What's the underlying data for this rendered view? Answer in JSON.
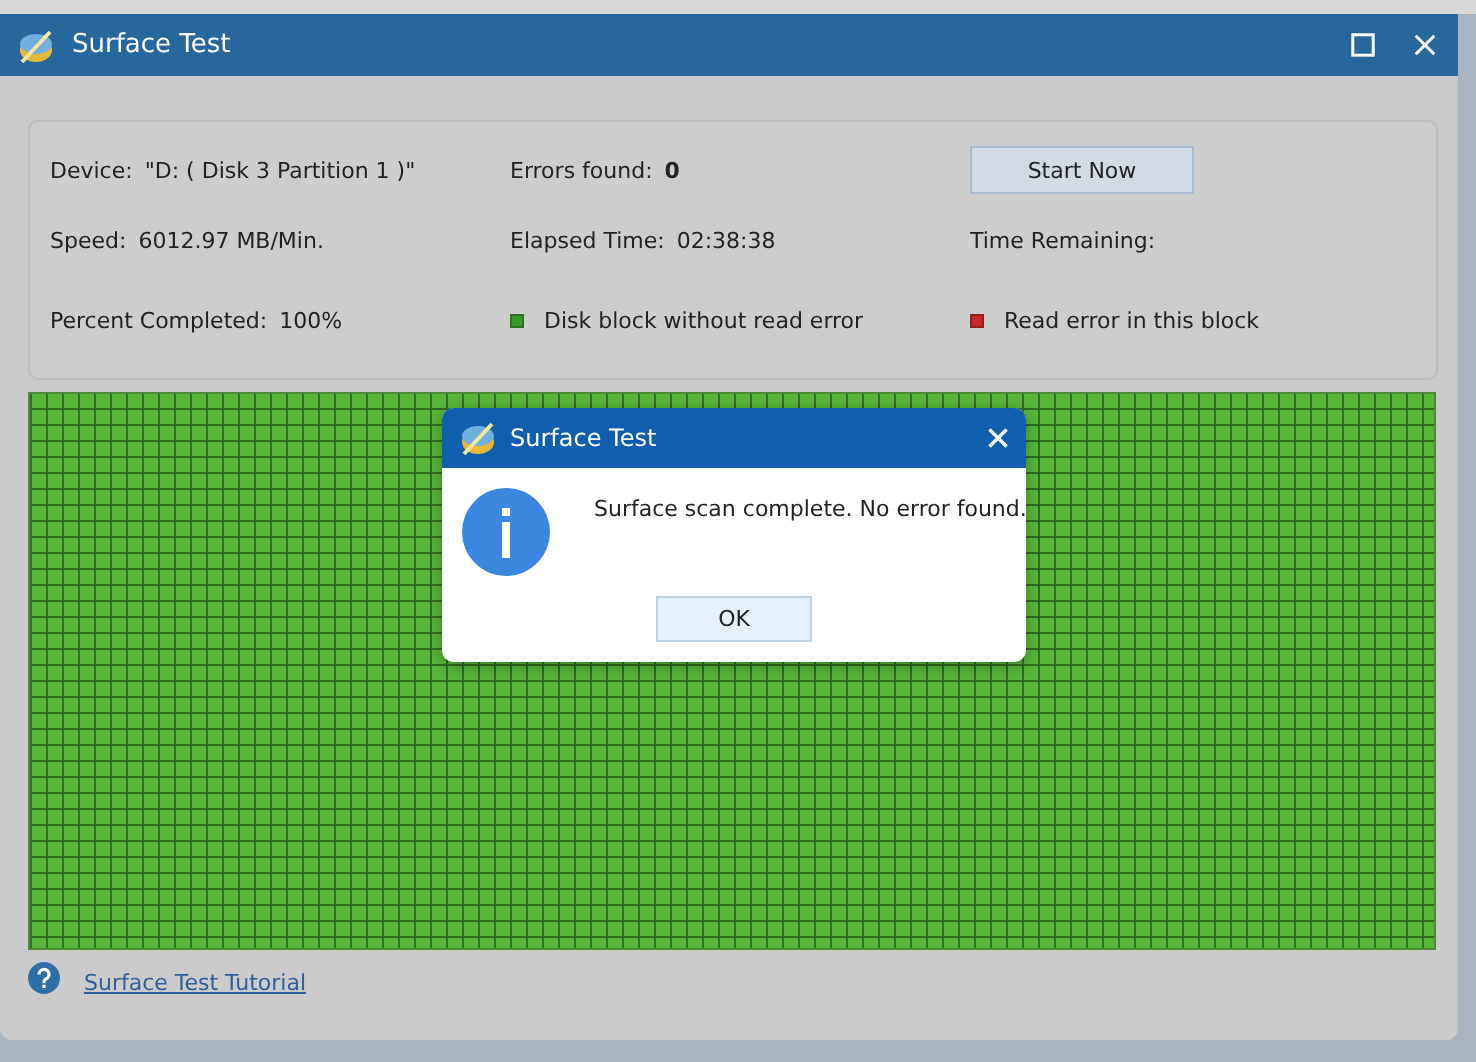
{
  "window": {
    "title": "Surface Test"
  },
  "info": {
    "rows": [
      [
        {
          "label": "Device:",
          "value": "\"D: ( Disk 3 Partition 1 )\""
        },
        {
          "label": "Errors found:",
          "value": "0",
          "bold": true
        }
      ],
      [
        {
          "label": "Speed:",
          "value": "6012.97 MB/Min."
        },
        {
          "label": "Elapsed Time:",
          "value": "02:38:38"
        },
        {
          "label": "Time Remaining:"
        }
      ],
      [
        {
          "label": "Percent Completed:",
          "value": "100%"
        }
      ]
    ],
    "start_button": "Start Now",
    "legend": [
      {
        "label": "Disk block without read error",
        "color": "#3c9a2c"
      },
      {
        "label": "Read error in this block",
        "color": "#c42a2a"
      }
    ]
  },
  "dialog": {
    "title": "Surface Test",
    "message": "Surface scan complete. No error found.",
    "button": "OK"
  },
  "footer": {
    "link": "Surface Test Tutorial"
  }
}
